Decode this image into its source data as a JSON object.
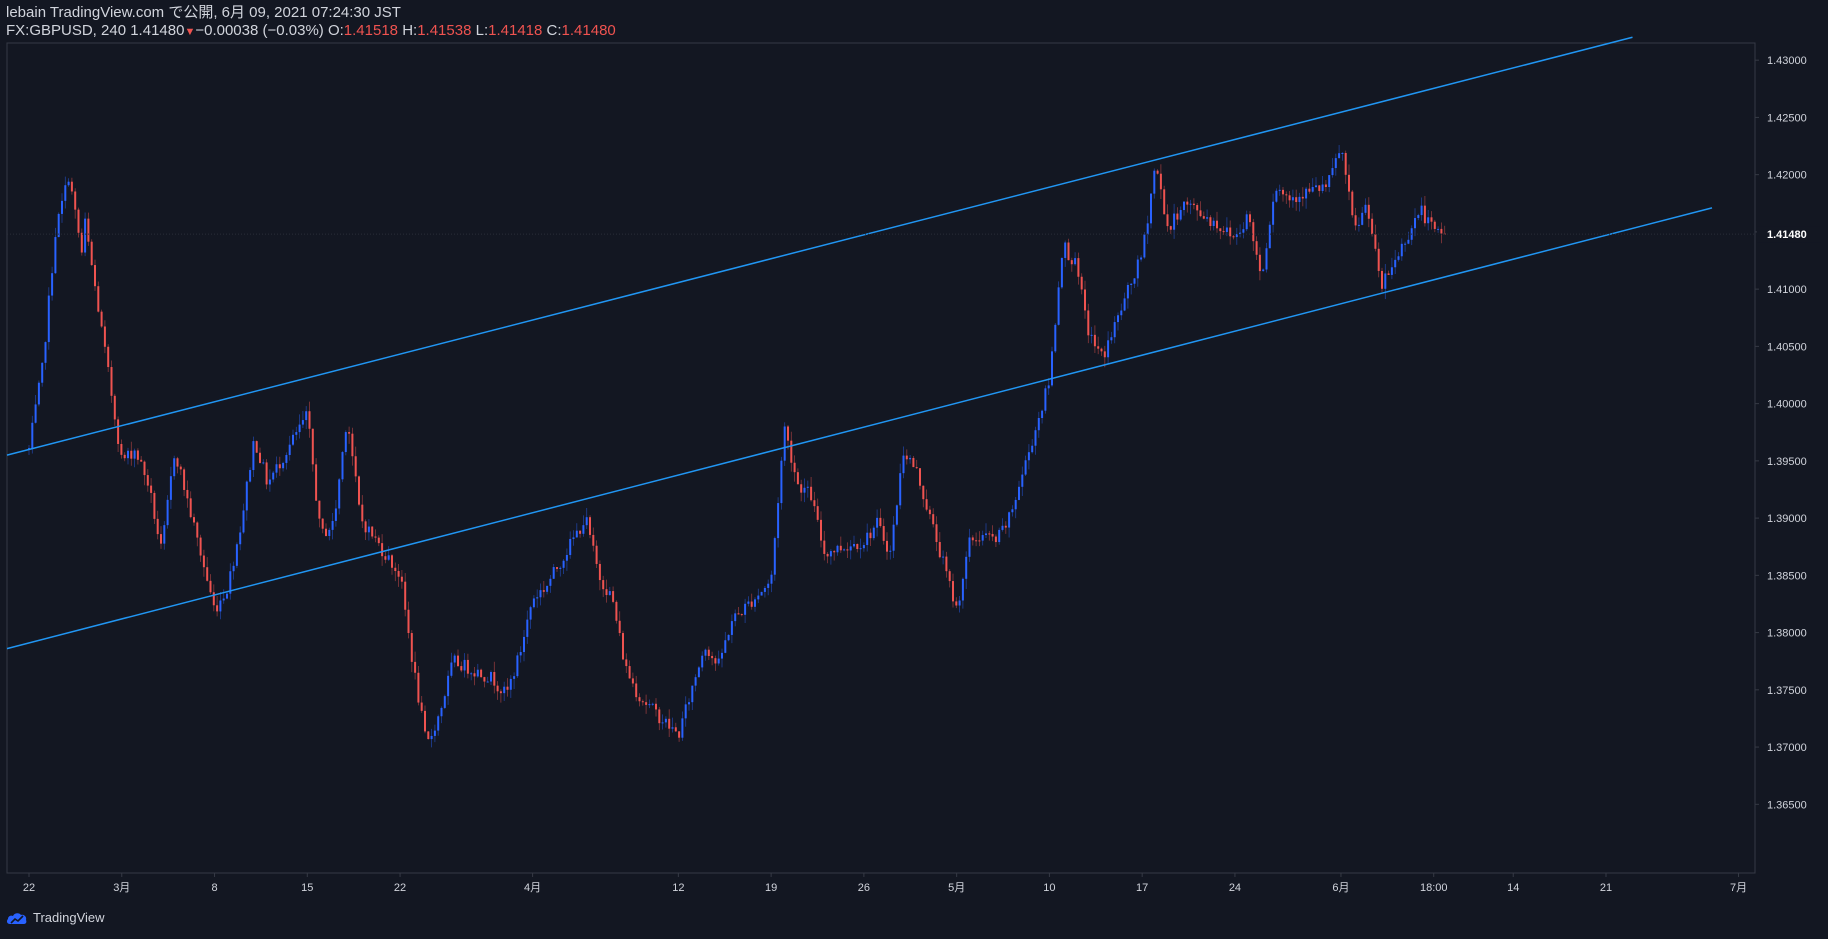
{
  "header": {
    "publisher": "lebain TradingView.com で公開, 6月 09, 2021 07:24:30 JST",
    "symbol": "FX:GBPUSD, 240",
    "last": "1.41480",
    "change": "−0.00038 (−0.03%)",
    "o_label": "O:",
    "o_value": "1.41518",
    "h_label": "H:",
    "h_value": "1.41538",
    "l_label": "L:",
    "l_value": "1.41418",
    "c_label": "C:",
    "c_value": "1.41480"
  },
  "footer": {
    "brand": "TradingView"
  },
  "colors": {
    "background": "#131722",
    "up_candle": "#2962ff",
    "down_candle": "#ef5350",
    "channel_line": "#2196f3",
    "text": "#d1d4dc",
    "axis_line": "#363a45"
  },
  "chart_data": {
    "type": "candlestick",
    "symbol": "GBPUSD",
    "interval": "240",
    "x_ticks": [
      "22",
      "3月",
      "8",
      "15",
      "22",
      "4月",
      "12",
      "19",
      "26",
      "5月",
      "10",
      "17",
      "24",
      "6月",
      "18:00",
      "14",
      "21",
      "7月"
    ],
    "y_ticks": [
      "1.43000",
      "1.42500",
      "1.42000",
      "1.41500",
      "1.41000",
      "1.40500",
      "1.40000",
      "1.39500",
      "1.39000",
      "1.38500",
      "1.38000",
      "1.37500",
      "1.37000",
      "1.36500"
    ],
    "ylim": [
      1.359,
      1.4315
    ],
    "last_price": "1.41480",
    "price_path": [
      [
        "2021-02-22",
        1.396
      ],
      [
        "2021-02-23",
        1.403
      ],
      [
        "2021-02-24",
        1.415
      ],
      [
        "2021-02-25",
        1.42
      ],
      [
        "2021-02-26",
        1.413
      ],
      [
        "2021-02-26",
        1.4175
      ],
      [
        "2021-03-01",
        1.395
      ],
      [
        "2021-03-02",
        1.396
      ],
      [
        "2021-03-03",
        1.393
      ],
      [
        "2021-03-04",
        1.387
      ],
      [
        "2021-03-05",
        1.396
      ],
      [
        "2021-03-08",
        1.382
      ],
      [
        "2021-03-09",
        1.384
      ],
      [
        "2021-03-10",
        1.3895
      ],
      [
        "2021-03-11",
        1.397
      ],
      [
        "2021-03-12",
        1.393
      ],
      [
        "2021-03-15",
        1.399
      ],
      [
        "2021-03-16",
        1.3885
      ],
      [
        "2021-03-17",
        1.3895
      ],
      [
        "2021-03-18",
        1.399
      ],
      [
        "2021-03-19",
        1.39
      ],
      [
        "2021-03-22",
        1.385
      ],
      [
        "2021-03-23",
        1.377
      ],
      [
        "2021-03-24",
        1.37
      ],
      [
        "2021-03-25",
        1.373
      ],
      [
        "2021-03-26",
        1.3775
      ],
      [
        "2021-03-29",
        1.376
      ],
      [
        "2021-03-30",
        1.3745
      ],
      [
        "2021-03-31",
        1.378
      ],
      [
        "2021-04-01",
        1.383
      ],
      [
        "2021-04-02",
        1.384
      ],
      [
        "2021-04-05",
        1.39
      ],
      [
        "2021-04-06",
        1.385
      ],
      [
        "2021-04-07",
        1.383
      ],
      [
        "2021-04-08",
        1.377
      ],
      [
        "2021-04-09",
        1.3745
      ],
      [
        "2021-04-12",
        1.371
      ],
      [
        "2021-04-13",
        1.375
      ],
      [
        "2021-04-14",
        1.379
      ],
      [
        "2021-04-15",
        1.377
      ],
      [
        "2021-04-16",
        1.381
      ],
      [
        "2021-04-19",
        1.3845
      ],
      [
        "2021-04-20",
        1.398
      ],
      [
        "2021-04-21",
        1.393
      ],
      [
        "2021-04-22",
        1.392
      ],
      [
        "2021-04-23",
        1.387
      ],
      [
        "2021-04-26",
        1.388
      ],
      [
        "2021-04-27",
        1.3895
      ],
      [
        "2021-04-28",
        1.387
      ],
      [
        "2021-04-29",
        1.396
      ],
      [
        "2021-04-30",
        1.394
      ],
      [
        "2021-05-03",
        1.382
      ],
      [
        "2021-05-04",
        1.388
      ],
      [
        "2021-05-05",
        1.3885
      ],
      [
        "2021-05-06",
        1.388
      ],
      [
        "2021-05-07",
        1.39
      ],
      [
        "2021-05-10",
        1.402
      ],
      [
        "2021-05-11",
        1.414
      ],
      [
        "2021-05-12",
        1.412
      ],
      [
        "2021-05-13",
        1.406
      ],
      [
        "2021-05-14",
        1.404
      ],
      [
        "2021-05-17",
        1.413
      ],
      [
        "2021-05-18",
        1.421
      ],
      [
        "2021-05-19",
        1.415
      ],
      [
        "2021-05-20",
        1.4175
      ],
      [
        "2021-05-21",
        1.417
      ],
      [
        "2021-05-24",
        1.4145
      ],
      [
        "2021-05-25",
        1.4165
      ],
      [
        "2021-05-26",
        1.411
      ],
      [
        "2021-05-27",
        1.419
      ],
      [
        "2021-05-28",
        1.418
      ],
      [
        "2021-05-31",
        1.419
      ],
      [
        "2021-06-01",
        1.4225
      ],
      [
        "2021-06-02",
        1.415
      ],
      [
        "2021-06-03",
        1.4175
      ],
      [
        "2021-06-04",
        1.41
      ],
      [
        "2021-06-07",
        1.417
      ],
      [
        "2021-06-08",
        1.415
      ],
      [
        "2021-06-09",
        1.4148
      ]
    ],
    "channel_lines": [
      {
        "name": "upper",
        "from": [
          "2021-02-22",
          1.3955
        ],
        "to": [
          "2021-06-23",
          1.432
        ]
      },
      {
        "name": "lower",
        "from": [
          "2021-02-22",
          1.3786
        ],
        "to": [
          "2021-06-29",
          1.4171
        ]
      }
    ]
  }
}
